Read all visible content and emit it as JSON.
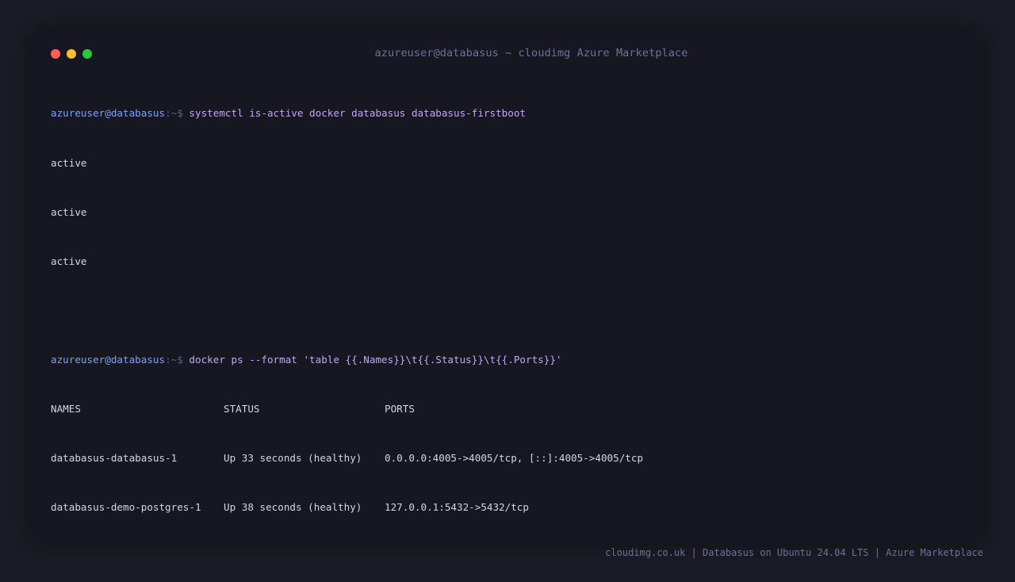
{
  "window": {
    "title": "azureuser@databasus ~ cloudimg Azure Marketplace",
    "controls": [
      "close",
      "minimize",
      "maximize"
    ]
  },
  "session": {
    "prompt_user": "azureuser@databasus",
    "prompt_path": ":~$",
    "commands": [
      {
        "command": "systemctl is-active docker databasus databasus-firstboot",
        "output": [
          "active",
          "active",
          "active"
        ]
      },
      {
        "command": "docker ps --format 'table {{.Names}}\\t{{.Status}}\\t{{.Ports}}'",
        "table": {
          "headers": [
            "NAMES",
            "STATUS",
            "PORTS"
          ],
          "rows": [
            [
              "databasus-databasus-1",
              "Up 33 seconds (healthy)",
              "0.0.0.0:4005->4005/tcp, [::]:4005->4005/tcp"
            ],
            [
              "databasus-demo-postgres-1",
              "Up 38 seconds (healthy)",
              "127.0.0.1:5432->5432/tcp"
            ]
          ]
        }
      }
    ]
  },
  "footer": {
    "text": "cloudimg.co.uk | Databasus on Ubuntu 24.04 LTS | Azure Marketplace"
  },
  "colors": {
    "background": "#1b1c26",
    "terminal": "#161720",
    "prompt_user": "#7aa2f7",
    "command": "#c3a6f7",
    "output": "#d4d6e2"
  }
}
